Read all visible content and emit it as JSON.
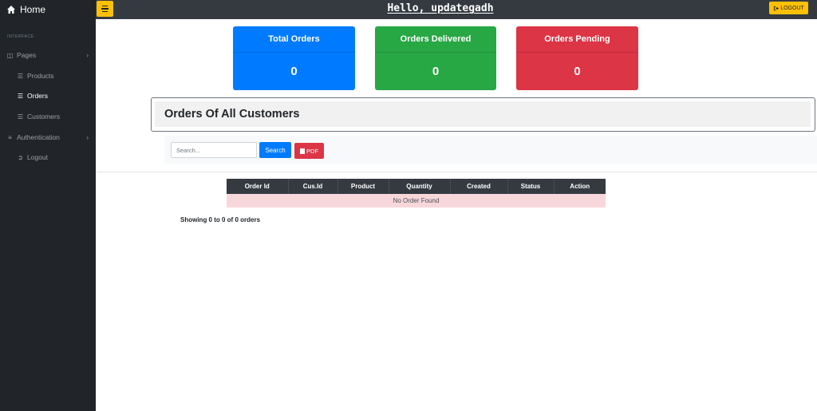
{
  "header": {
    "brand_label": "Home",
    "greeting": "Hello, updategadh",
    "logout_label": "LOGOUT"
  },
  "sidebar": {
    "heading": "INTERFACE",
    "items": [
      {
        "label": "Pages",
        "icon": "columns-icon",
        "chevron": true
      },
      {
        "label": "Products",
        "icon": "list-icon"
      },
      {
        "label": "Orders",
        "icon": "list-icon",
        "active": true
      },
      {
        "label": "Customers",
        "icon": "list-icon"
      },
      {
        "label": "Authentication",
        "icon": "book-icon",
        "chevron": true
      },
      {
        "label": "Logout",
        "icon": "sign-out-icon"
      }
    ]
  },
  "stats": {
    "total": {
      "label": "Total Orders",
      "value": "0",
      "color": "#007bff"
    },
    "delivered": {
      "label": "Orders Delivered",
      "value": "0",
      "color": "#28a745"
    },
    "pending": {
      "label": "Orders Pending",
      "value": "0",
      "color": "#dc3545"
    }
  },
  "orders": {
    "title": "Orders Of All Customers",
    "search_placeholder": "Search...",
    "search_button": "Search",
    "pdf_button": "PDF",
    "columns": [
      "Order Id",
      "Cus.Id",
      "Product",
      "Quantity",
      "Created",
      "Status",
      "Action"
    ],
    "empty_message": "No Order Found",
    "showing": "Showing 0 to 0 of 0 orders"
  },
  "colors": {
    "accent": "#ffc107",
    "sidebar_bg": "#212529",
    "topbar_bg": "#343a40"
  }
}
